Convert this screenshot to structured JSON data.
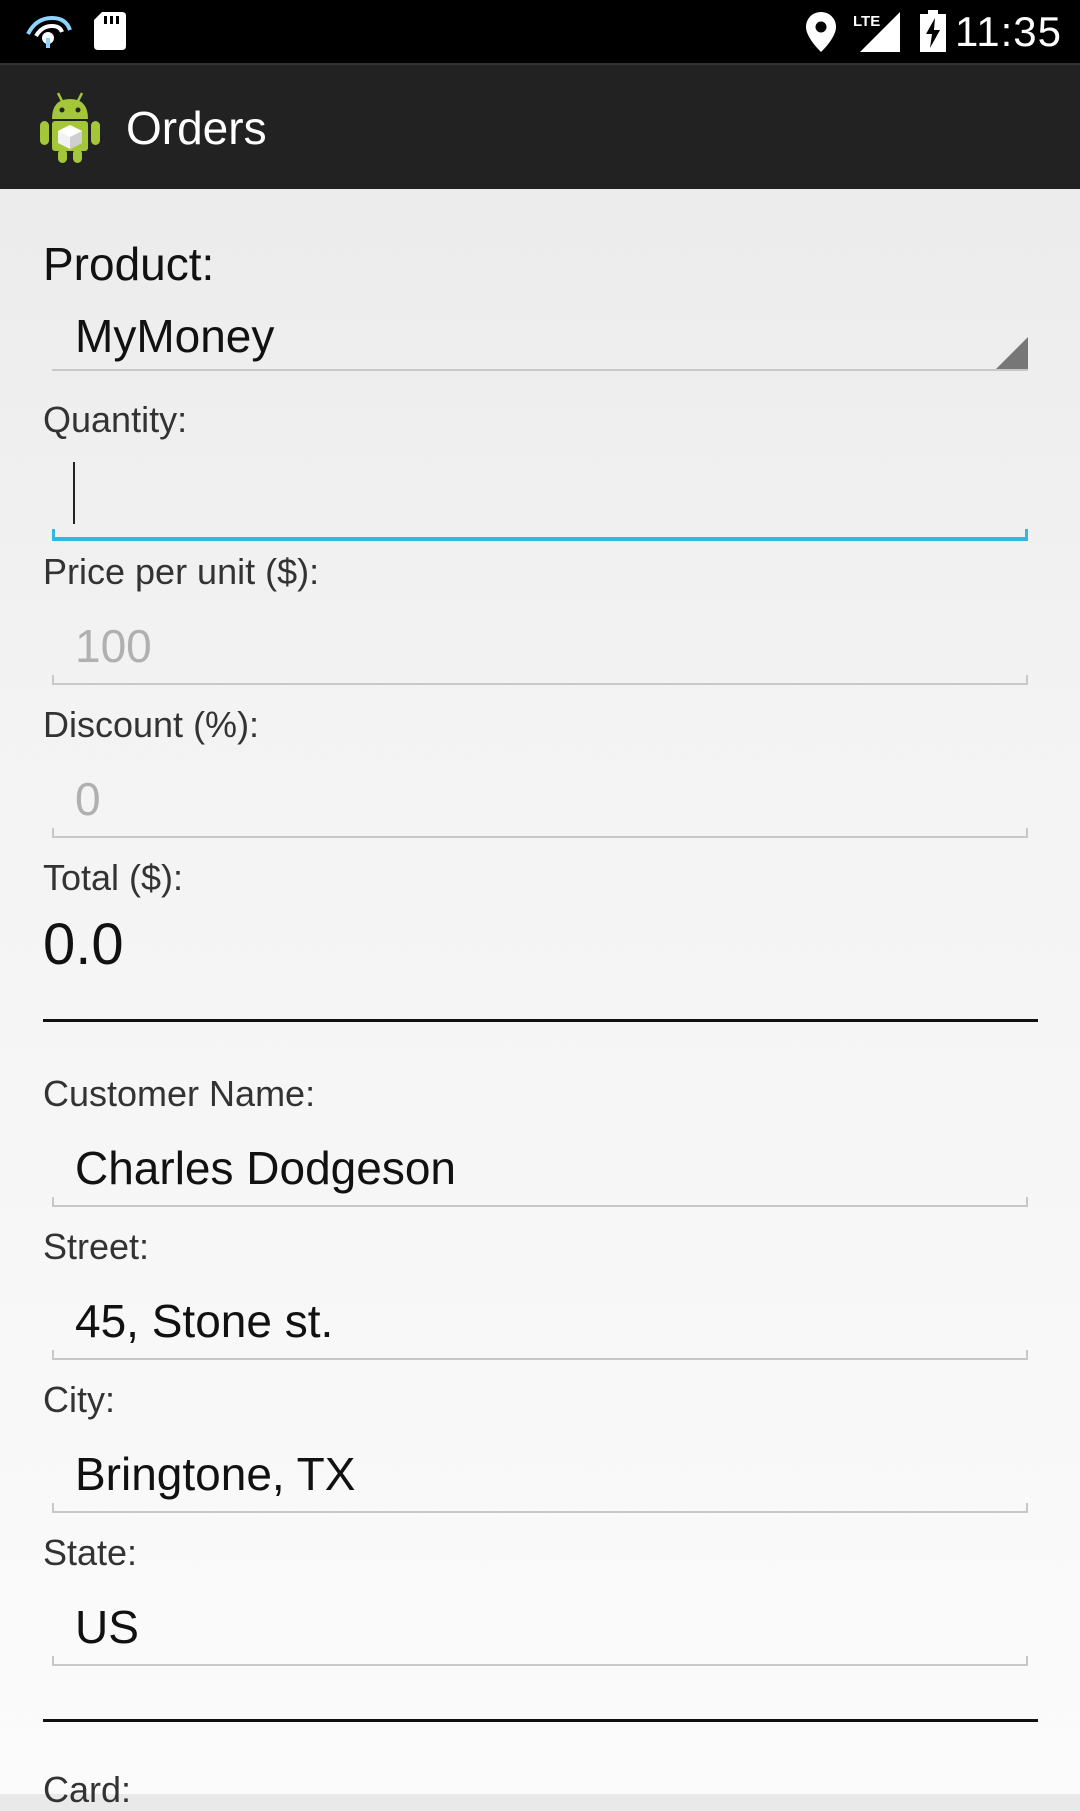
{
  "status_bar": {
    "time": "11:35",
    "icons": [
      "hotspot-icon",
      "sd-card-icon",
      "location-icon",
      "lte-signal-icon",
      "battery-charging-icon"
    ],
    "lte_label": "LTE"
  },
  "action_bar": {
    "title": "Orders",
    "logo_icon": "android-app-icon"
  },
  "form": {
    "product": {
      "label": "Product:",
      "selected": "MyMoney"
    },
    "quantity": {
      "label": "Quantity:",
      "value": ""
    },
    "price": {
      "label": "Price per unit ($):",
      "value": "100"
    },
    "discount": {
      "label": "Discount (%):",
      "value": "0"
    },
    "total": {
      "label": "Total ($):",
      "value": "0.0"
    },
    "customer_name": {
      "label": "Customer Name:",
      "value": "Charles Dodgeson"
    },
    "street": {
      "label": "Street:",
      "value": "45, Stone st."
    },
    "city": {
      "label": "City:",
      "value": "Bringtone, TX"
    },
    "state": {
      "label": "State:",
      "value": "US"
    },
    "card": {
      "label": "Card:"
    }
  },
  "colors": {
    "status_bar": "#000000",
    "action_bar": "#222222",
    "focus_accent": "#33b5e5",
    "disabled_text": "#b0b0b0"
  }
}
